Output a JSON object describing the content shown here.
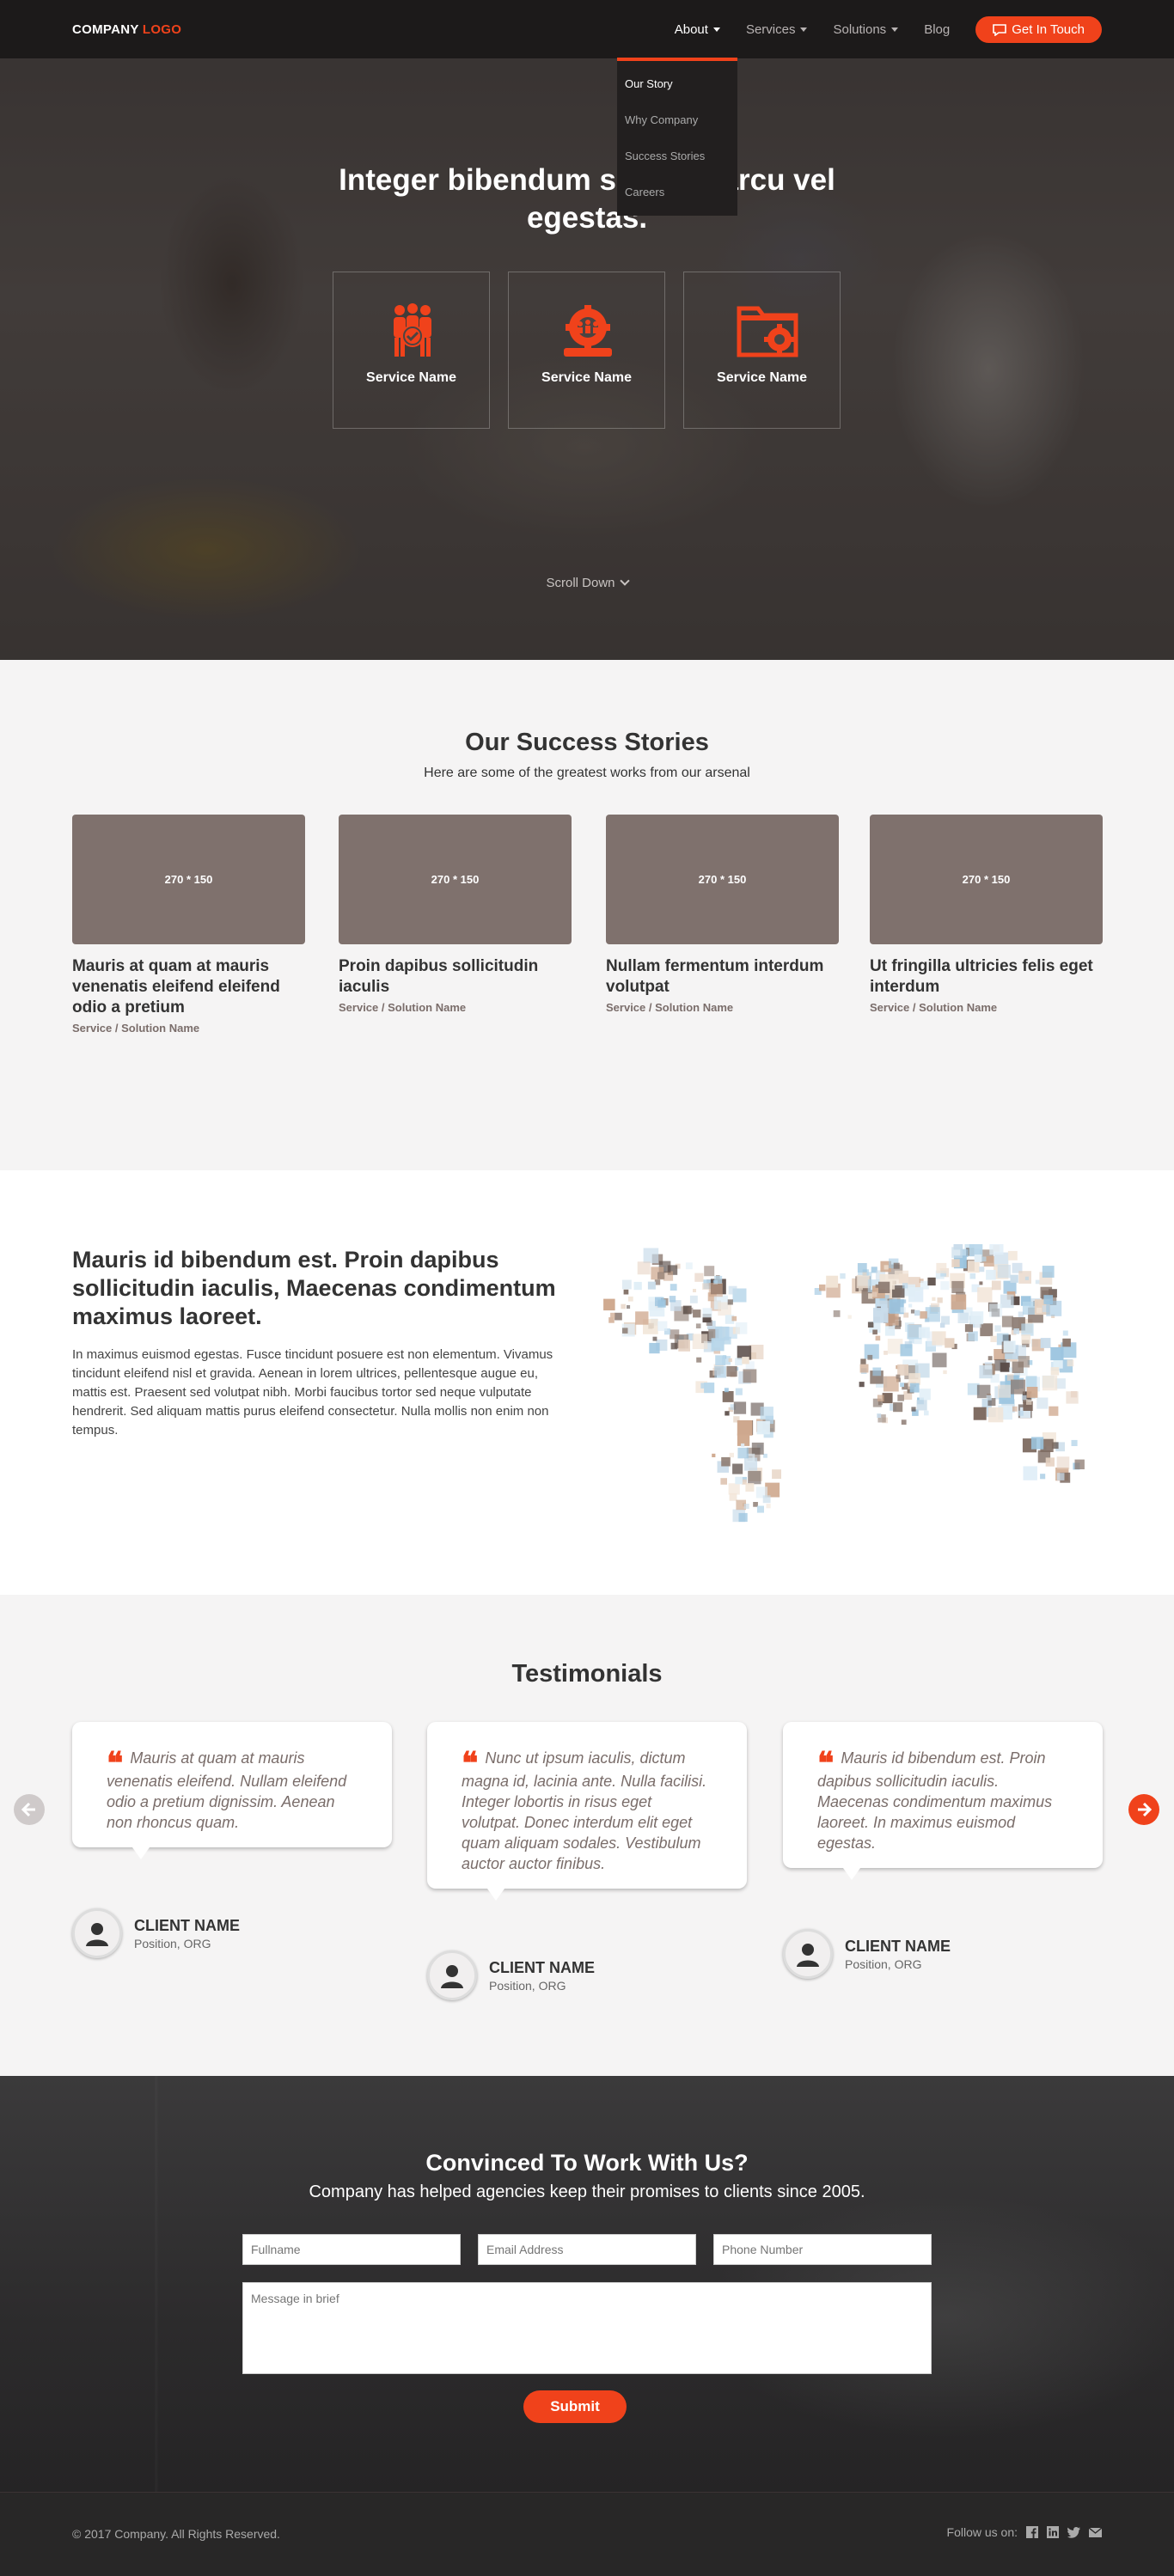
{
  "brand": {
    "logo_part1": "COMPANY",
    "logo_part2": "LOGO",
    "accent_color": "#f0421b"
  },
  "nav": {
    "items": [
      {
        "label": "About",
        "has_caret": true
      },
      {
        "label": "Services",
        "has_caret": true
      },
      {
        "label": "Solutions",
        "has_caret": true
      },
      {
        "label": "Blog",
        "has_caret": false
      }
    ],
    "cta_label": "Get In Touch",
    "about_dropdown": [
      "Our Story",
      "Why Company",
      "Success Stories",
      "Careers"
    ]
  },
  "hero": {
    "title": "Integer bibendum sit amet arcu vel egestas.",
    "services": [
      {
        "label": "Service Name",
        "icon": "team-icon"
      },
      {
        "label": "Service Name",
        "icon": "gear-team-icon"
      },
      {
        "label": "Service Name",
        "icon": "folder-gear-icon"
      }
    ],
    "scroll_label": "Scroll Down"
  },
  "stories": {
    "title": "Our Success Stories",
    "subtitle": "Here are some of the greatest works from our arsenal",
    "cards": [
      {
        "thumb": "270 * 150",
        "title": "Mauris at quam at mauris venenatis eleifend eleifend odio a pretium",
        "tag": "Service / Solution Name"
      },
      {
        "thumb": "270 * 150",
        "title": "Proin dapibus sollicitudin iaculis",
        "tag": "Service / Solution Name"
      },
      {
        "thumb": "270 * 150",
        "title": "Nullam fermentum interdum volutpat",
        "tag": "Service / Solution Name"
      },
      {
        "thumb": "270 * 150",
        "title": "Ut fringilla ultricies felis eget interdum",
        "tag": "Service / Solution Name"
      }
    ]
  },
  "about": {
    "title": "Mauris id bibendum est. Proin dapibus sollicitudin iaculis, Maecenas condimentum maximus laoreet.",
    "body": "In maximus euismod egestas. Fusce tincidunt posuere est non elementum. Vivamus tincidunt eleifend nisl et gravida. Aenean in lorem ultrices, pellentesque augue eu, mattis est. Praesent sed volutpat nibh. Morbi faucibus tortor sed neque vulputate hendrerit. Sed aliquam mattis purus eleifend consectetur. Nulla mollis non enim non tempus."
  },
  "testimonials": {
    "title": "Testimonials",
    "items": [
      {
        "quote": "Mauris at quam at mauris venenatis eleifend. Nullam eleifend odio a pretium dignissim. Aenean non rhoncus quam.",
        "name": "CLIENT NAME",
        "position": "Position, ORG"
      },
      {
        "quote": "Nunc ut ipsum iaculis, dictum magna id, lacinia ante. Nulla facilisi. Integer lobortis in risus eget volutpat. Donec interdum elit eget quam aliquam sodales. Vestibulum auctor auctor finibus.",
        "name": "CLIENT NAME",
        "position": "Position, ORG"
      },
      {
        "quote": "Mauris id bibendum est. Proin dapibus sollicitudin iaculis. Maecenas condimentum maximus laoreet. In maximus euismod egestas.",
        "name": "CLIENT NAME",
        "position": "Position, ORG"
      }
    ]
  },
  "contact": {
    "title": "Convinced To Work With Us?",
    "subtitle": "Company has helped agencies keep their promises to clients since 2005.",
    "fullname_placeholder": "Fullname",
    "email_placeholder": "Email Address",
    "phone_placeholder": "Phone Number",
    "message_placeholder": "Message in brief",
    "submit_label": "Submit"
  },
  "footer": {
    "copyright": "© 2017 Company. All Rights Reserved.",
    "follow_label": "Follow us on:",
    "social": [
      "facebook-icon",
      "linkedin-icon",
      "twitter-icon",
      "email-icon"
    ]
  }
}
